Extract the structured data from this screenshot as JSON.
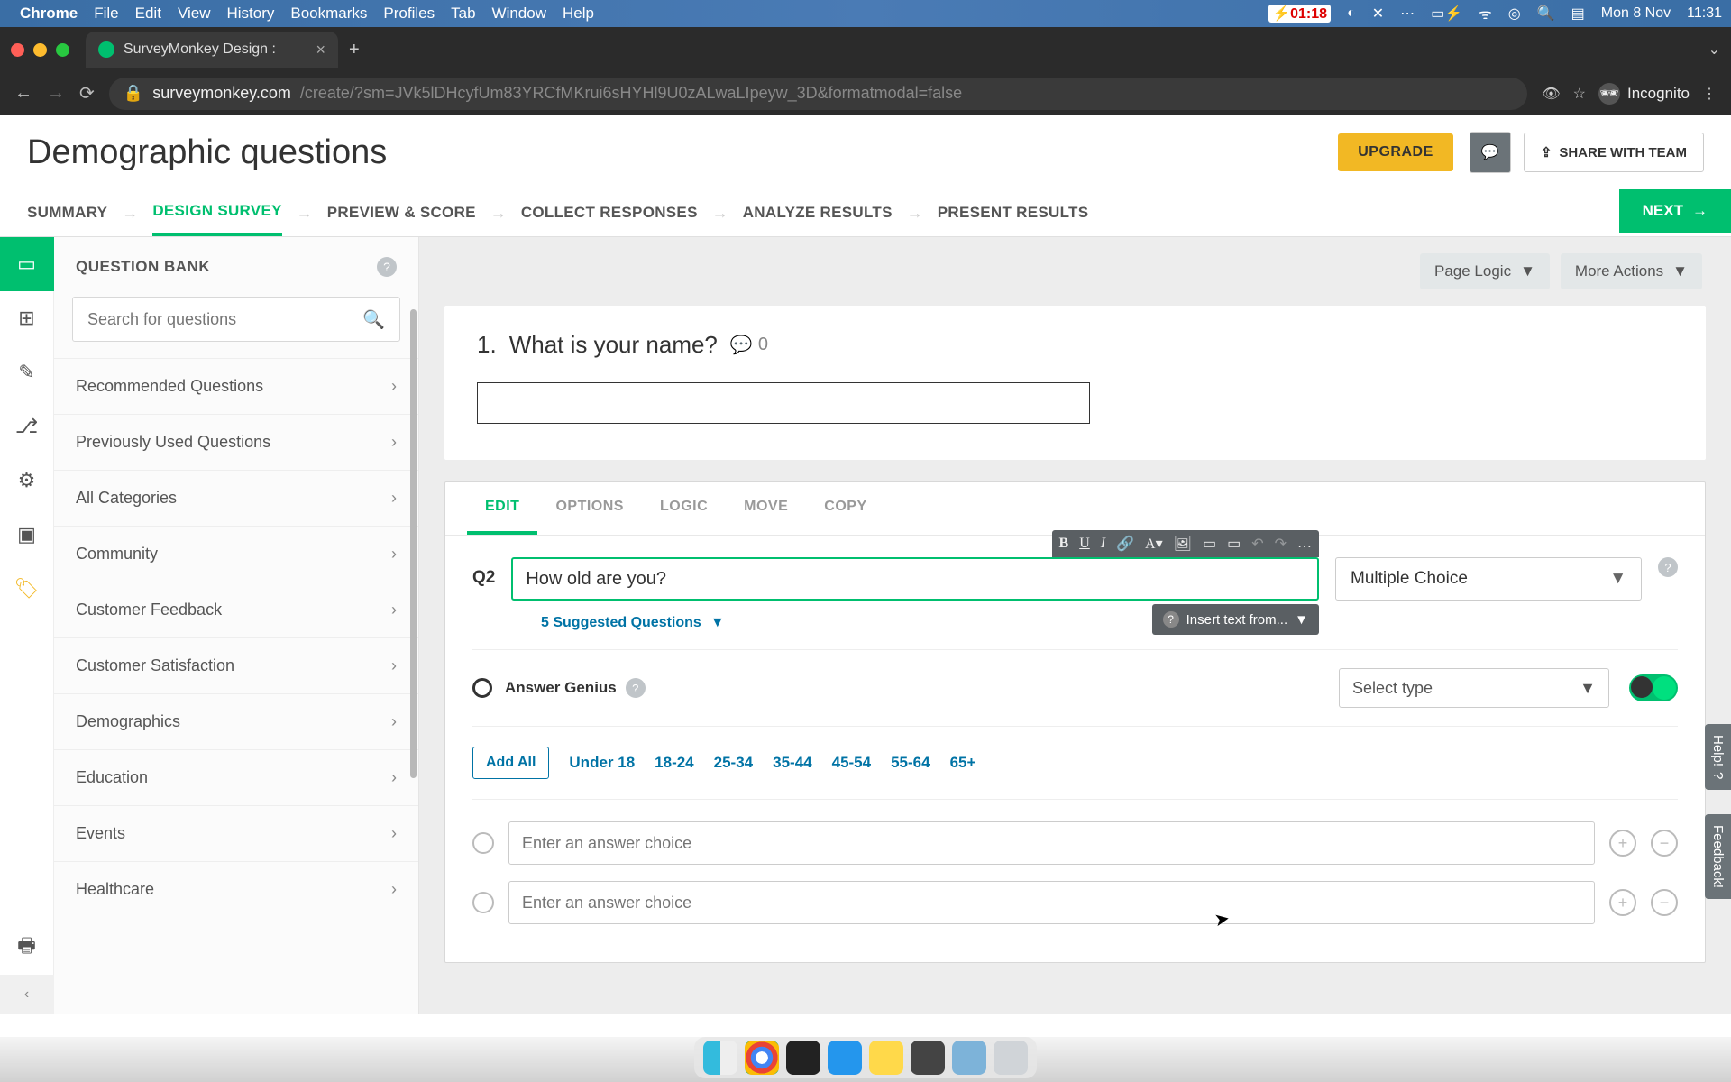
{
  "mac_menu": {
    "app": "Chrome",
    "items": [
      "File",
      "Edit",
      "View",
      "History",
      "Bookmarks",
      "Profiles",
      "Tab",
      "Window",
      "Help"
    ],
    "battery": "01:18",
    "date": "Mon 8 Nov",
    "time": "11:31"
  },
  "browser": {
    "tab_title": "SurveyMonkey Design :",
    "url_domain": "surveymonkey.com",
    "url_path": "/create/?sm=JVk5lDHcyfUm83YRCfMKrui6sHYHl9U0zALwaLIpeyw_3D&formatmodal=false",
    "incognito_label": "Incognito"
  },
  "page": {
    "title": "Demographic questions",
    "upgrade": "UPGRADE",
    "share": "SHARE WITH TEAM",
    "steps": [
      "SUMMARY",
      "DESIGN SURVEY",
      "PREVIEW & SCORE",
      "COLLECT RESPONSES",
      "ANALYZE RESULTS",
      "PRESENT RESULTS"
    ],
    "active_step_index": 1,
    "next": "NEXT"
  },
  "sidebar": {
    "title": "QUESTION BANK",
    "search_placeholder": "Search for questions",
    "categories": [
      "Recommended Questions",
      "Previously Used Questions",
      "All Categories",
      "Community",
      "Customer Feedback",
      "Customer Satisfaction",
      "Demographics",
      "Education",
      "Events",
      "Healthcare"
    ]
  },
  "canvas": {
    "page_logic": "Page Logic",
    "more_actions": "More Actions",
    "q1": {
      "number": "1.",
      "text": "What is your name?",
      "comments": "0"
    }
  },
  "editor": {
    "tabs": [
      "EDIT",
      "OPTIONS",
      "LOGIC",
      "MOVE",
      "COPY"
    ],
    "active_tab_index": 0,
    "qnum": "Q2",
    "qtext": "How old are you?",
    "qtype": "Multiple Choice",
    "insert_text": "Insert text from...",
    "suggested": "5 Suggested Questions",
    "answer_genius": "Answer Genius",
    "select_type": "Select type",
    "add_all": "Add All",
    "chips": [
      "Under 18",
      "18-24",
      "25-34",
      "35-44",
      "45-54",
      "55-64",
      "65+"
    ],
    "answer_placeholder": "Enter an answer choice"
  },
  "side_tabs": {
    "help": "Help!",
    "feedback": "Feedback!"
  }
}
